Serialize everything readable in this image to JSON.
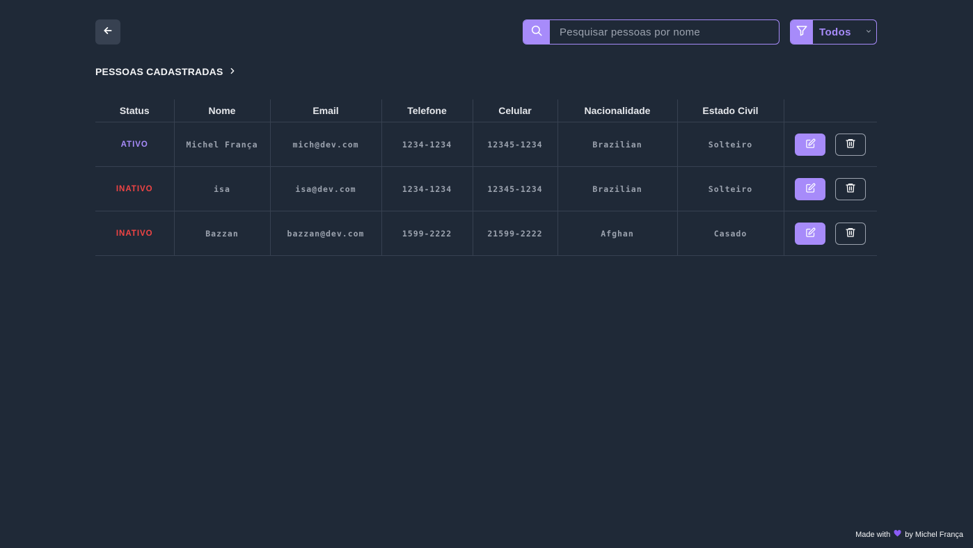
{
  "header": {
    "search_placeholder": "Pesquisar pessoas por nome",
    "search_value": "",
    "filter_value": "Todos"
  },
  "section": {
    "title": "PESSOAS CADASTRADAS"
  },
  "table": {
    "columns": [
      "Status",
      "Nome",
      "Email",
      "Telefone",
      "Celular",
      "Nacionalidade",
      "Estado Civil",
      ""
    ],
    "rows": [
      {
        "status": "ATIVO",
        "nome": "Michel França",
        "email": "mich@dev.com",
        "telefone": "1234-1234",
        "celular": "12345-1234",
        "nacionalidade": "Brazilian",
        "estado_civil": "Solteiro"
      },
      {
        "status": "INATIVO",
        "nome": "isa",
        "email": "isa@dev.com",
        "telefone": "1234-1234",
        "celular": "12345-1234",
        "nacionalidade": "Brazilian",
        "estado_civil": "Solteiro"
      },
      {
        "status": "INATIVO",
        "nome": "Bazzan",
        "email": "bazzan@dev.com",
        "telefone": "1599-2222",
        "celular": "21599-2222",
        "nacionalidade": "Afghan",
        "estado_civil": "Casado"
      }
    ]
  },
  "footer": {
    "made_with": "Made with",
    "by": "by Michel França"
  },
  "colors": {
    "background": "#1f2937",
    "accent": "#a78bfa",
    "active": "#a78bfa",
    "inactive": "#ef4444"
  },
  "icons": {
    "back": "arrow-left-icon",
    "search": "search-icon",
    "filter": "filter-icon",
    "dropdown": "chevron-down-icon",
    "section": "chevron-right-icon",
    "edit": "edit-icon",
    "delete": "trash-icon",
    "heart": "heart-icon"
  }
}
